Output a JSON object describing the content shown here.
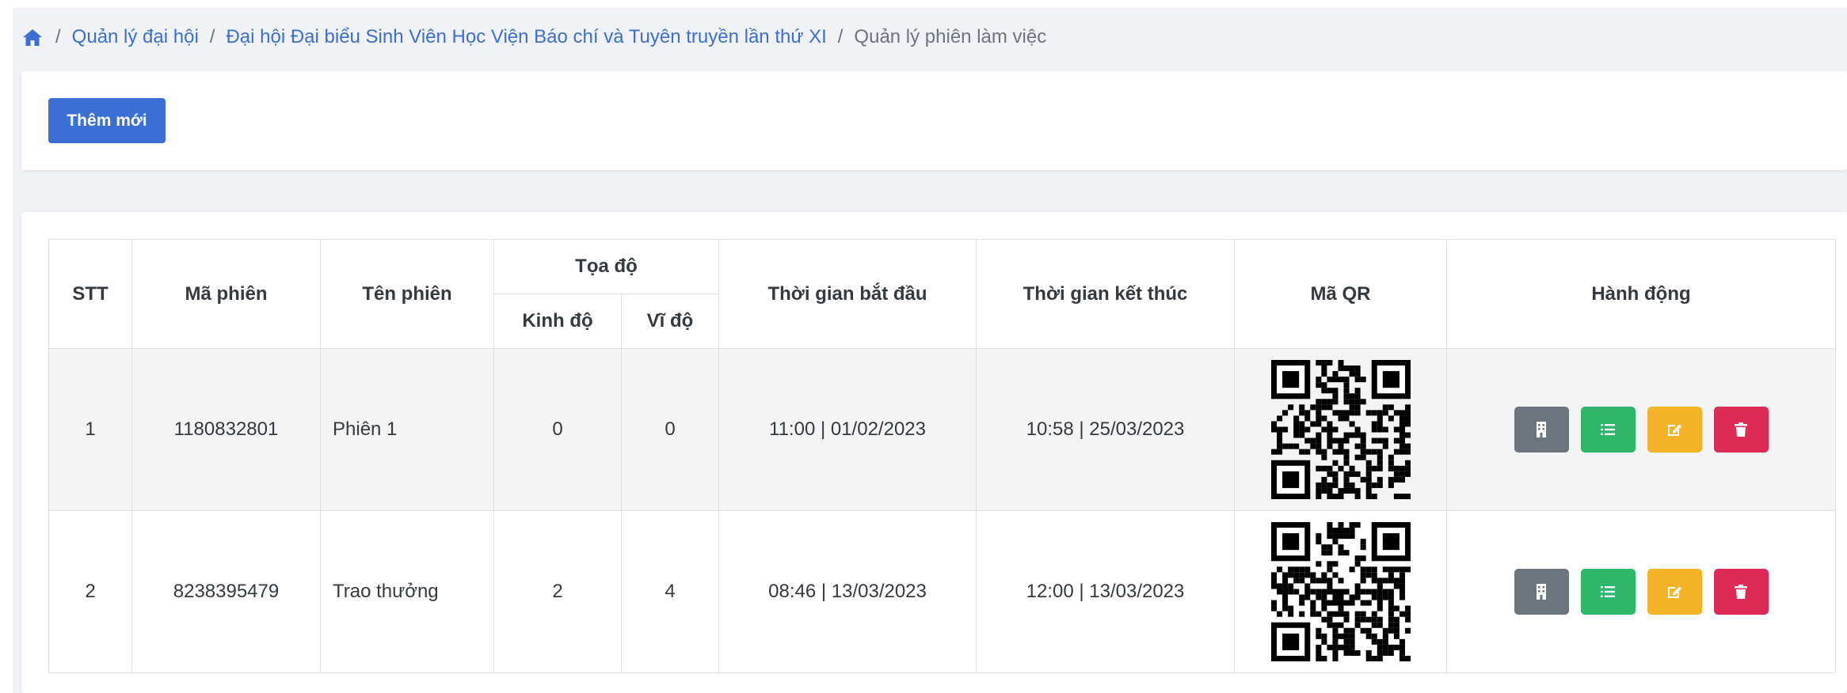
{
  "breadcrumb": {
    "home_icon": "home-icon",
    "items": [
      "Quản lý đại hội",
      "Đại hội Đại biểu Sinh Viên Học Viện Báo chí và Tuyên truyền lần thứ XI"
    ],
    "separator": "/",
    "current": "Quản lý phiên làm việc"
  },
  "toolbar": {
    "add_label": "Thêm mới"
  },
  "table": {
    "headers": {
      "stt": "STT",
      "code": "Mã phiên",
      "name": "Tên phiên",
      "coords": "Tọa độ",
      "longitude": "Kinh độ",
      "latitude": "Vĩ độ",
      "start": "Thời gian bắt đầu",
      "end": "Thời gian kết thúc",
      "qr": "Mã QR",
      "actions": "Hành động"
    },
    "rows": [
      {
        "stt": "1",
        "code": "1180832801",
        "name": "Phiên 1",
        "longitude": "0",
        "latitude": "0",
        "start": "11:00 | 01/02/2023",
        "end": "10:58 | 25/03/2023"
      },
      {
        "stt": "2",
        "code": "8238395479",
        "name": "Trao thưởng",
        "longitude": "2",
        "latitude": "4",
        "start": "08:46 | 13/03/2023",
        "end": "12:00 | 13/03/2023"
      }
    ],
    "action_icons": [
      "building-icon",
      "list-icon",
      "edit-icon",
      "trash-icon"
    ]
  },
  "colors": {
    "primary": "#3b6fd4",
    "secondary": "#6c757d",
    "success": "#2fb66b",
    "warning": "#f5b427",
    "danger": "#dc2b55"
  }
}
